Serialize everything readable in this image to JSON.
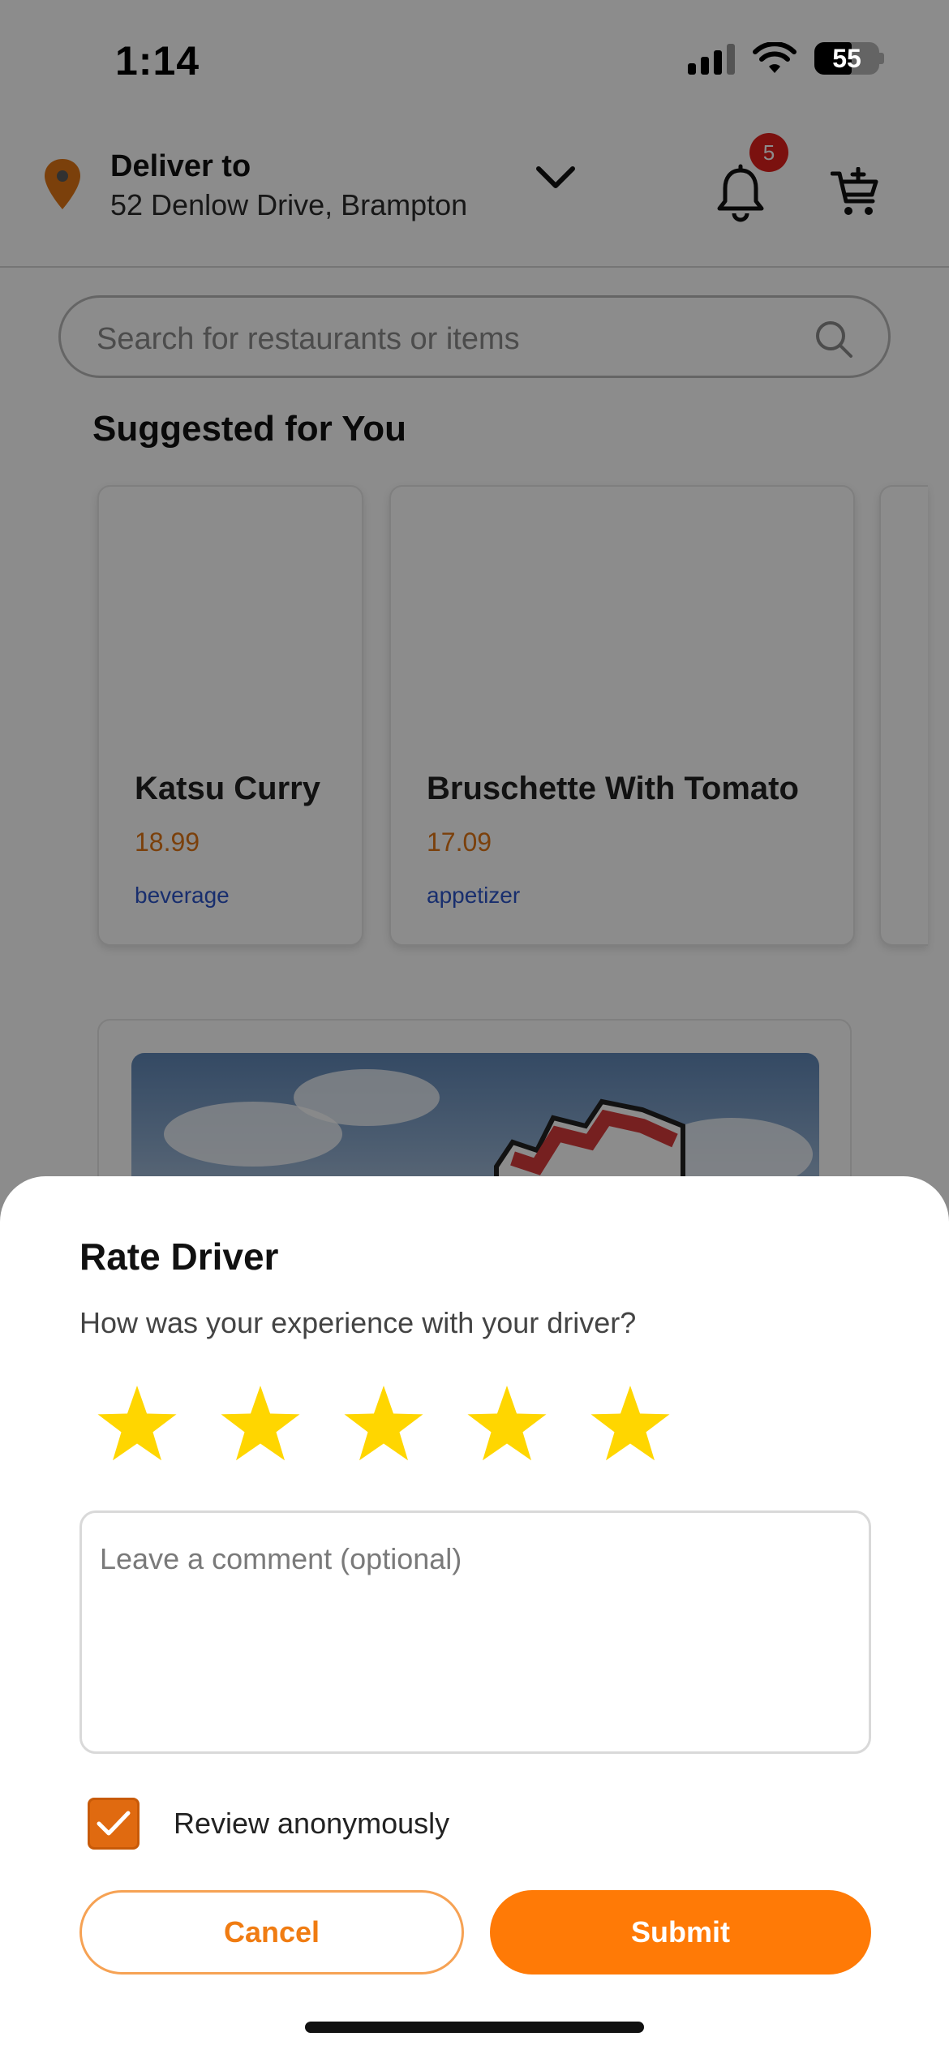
{
  "status_bar": {
    "time": "1:14",
    "battery": "55"
  },
  "header": {
    "deliver_label": "Deliver to",
    "address": "52 Denlow Drive, Brampton",
    "notification_count": "5"
  },
  "search": {
    "placeholder": "Search for restaurants or items"
  },
  "suggested": {
    "title": "Suggested for You",
    "items": [
      {
        "name": "Katsu Curry",
        "price": "18.99",
        "category": "beverage"
      },
      {
        "name": "Bruschette With Tomato",
        "price": "17.09",
        "category": "appetizer"
      }
    ]
  },
  "rate_driver": {
    "title": "Rate Driver",
    "subtitle": "How was your experience with your driver?",
    "rating": 5,
    "max_rating": 5,
    "comment_placeholder": "Leave a comment (optional)",
    "comment_value": "",
    "anonymous_label": "Review anonymously",
    "anonymous_checked": true,
    "cancel_label": "Cancel",
    "submit_label": "Submit"
  },
  "colors": {
    "accent": "#ff7a06",
    "star": "#ffd600",
    "badge": "#e0201c",
    "price": "#e07514",
    "tag": "#2c55c8"
  }
}
